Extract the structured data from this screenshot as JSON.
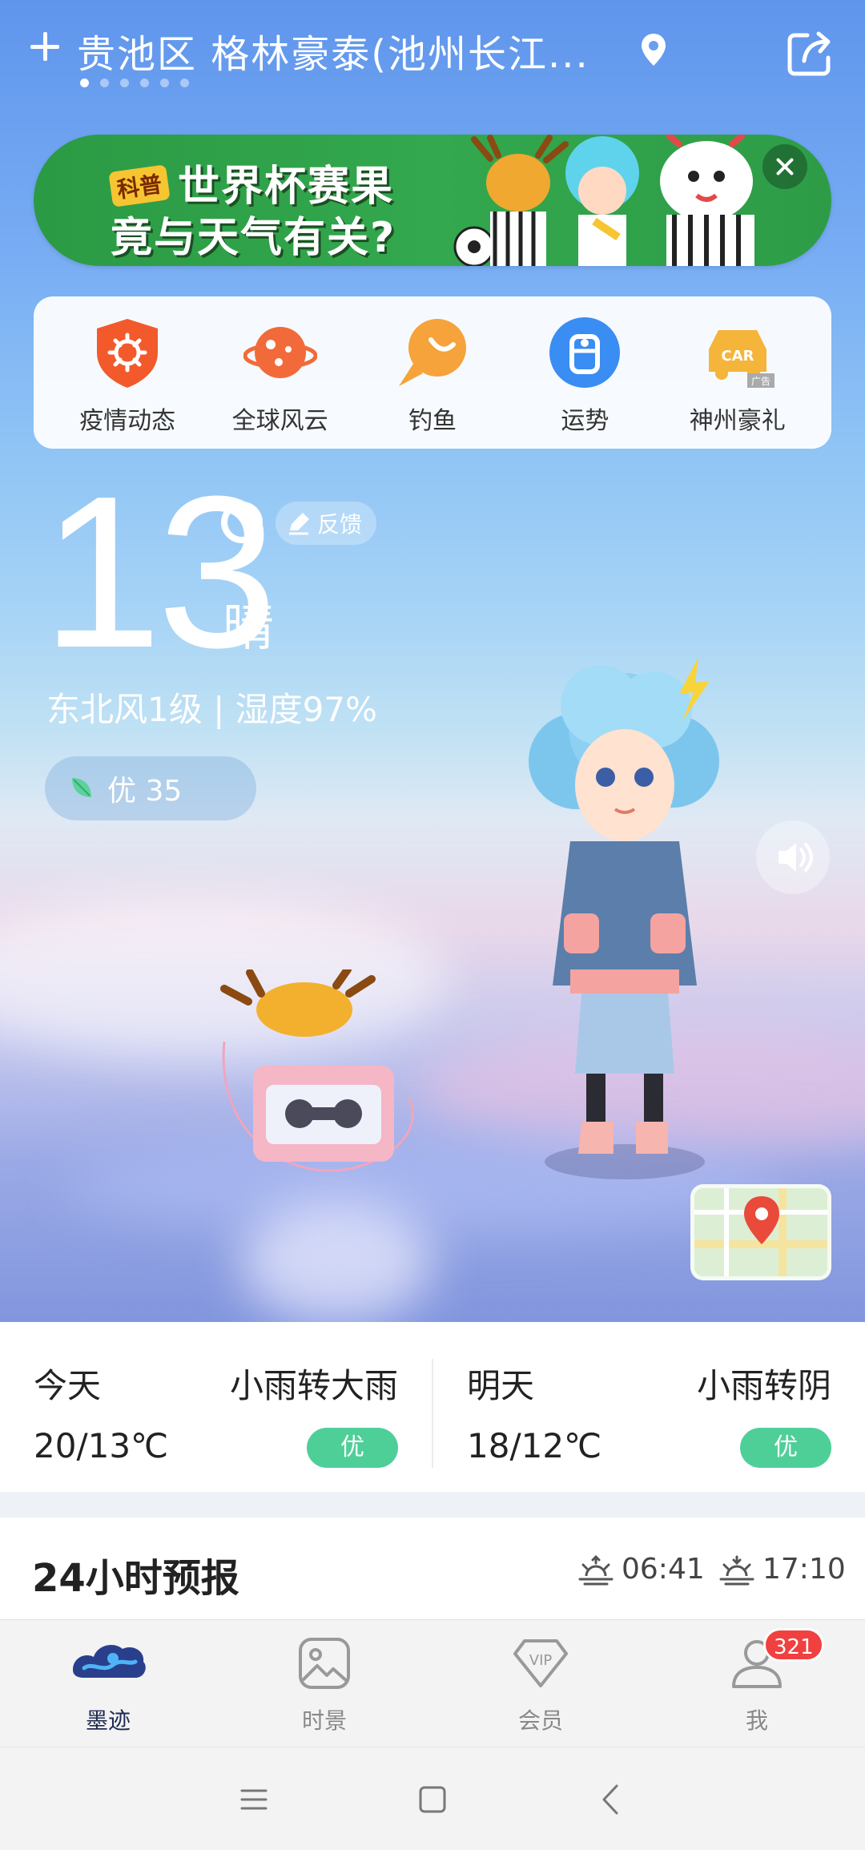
{
  "header": {
    "location": "贵池区 格林豪泰(池州长江...",
    "page_count": 6,
    "active_page": 0
  },
  "ad_banner": {
    "badge": "科普",
    "line1": "世界杯赛果",
    "line2": "竟与天气有关?"
  },
  "services": [
    {
      "label": "疫情动态",
      "icon": "virus-shield-icon",
      "color": "#f25a2c"
    },
    {
      "label": "全球风云",
      "icon": "planet-icon",
      "color": "#f26a3a"
    },
    {
      "label": "钓鱼",
      "icon": "fish-icon",
      "color": "#f5a33a"
    },
    {
      "label": "运势",
      "icon": "fortune-icon",
      "color": "#3a8df2"
    },
    {
      "label": "神州豪礼",
      "icon": "car-ad-icon",
      "color": "#f5b43a",
      "ad_tag": "广告"
    }
  ],
  "current": {
    "temperature": "13",
    "condition": "晴",
    "feedback_label": "反馈",
    "wind_humidity": "东北风1级 | 湿度97%",
    "aqi": "优 35"
  },
  "forecast": [
    {
      "day": "今天",
      "condition": "小雨转大雨",
      "temp": "20/13℃",
      "aqi": "优"
    },
    {
      "day": "明天",
      "condition": "小雨转阴",
      "temp": "18/12℃",
      "aqi": "优"
    }
  ],
  "hourly": {
    "title": "24小时预报",
    "sunrise": "06:41",
    "sunset": "17:10"
  },
  "nav": [
    {
      "label": "墨迹",
      "icon": "moji-logo-icon",
      "active": true
    },
    {
      "label": "时景",
      "icon": "image-icon",
      "active": false
    },
    {
      "label": "会员",
      "icon": "vip-icon",
      "active": false
    },
    {
      "label": "我",
      "icon": "user-icon",
      "active": false,
      "badge": "321"
    }
  ],
  "colors": {
    "aqi_good": "#4fcf98",
    "badge_red": "#f04040",
    "sky_top": "#5f95ec"
  }
}
